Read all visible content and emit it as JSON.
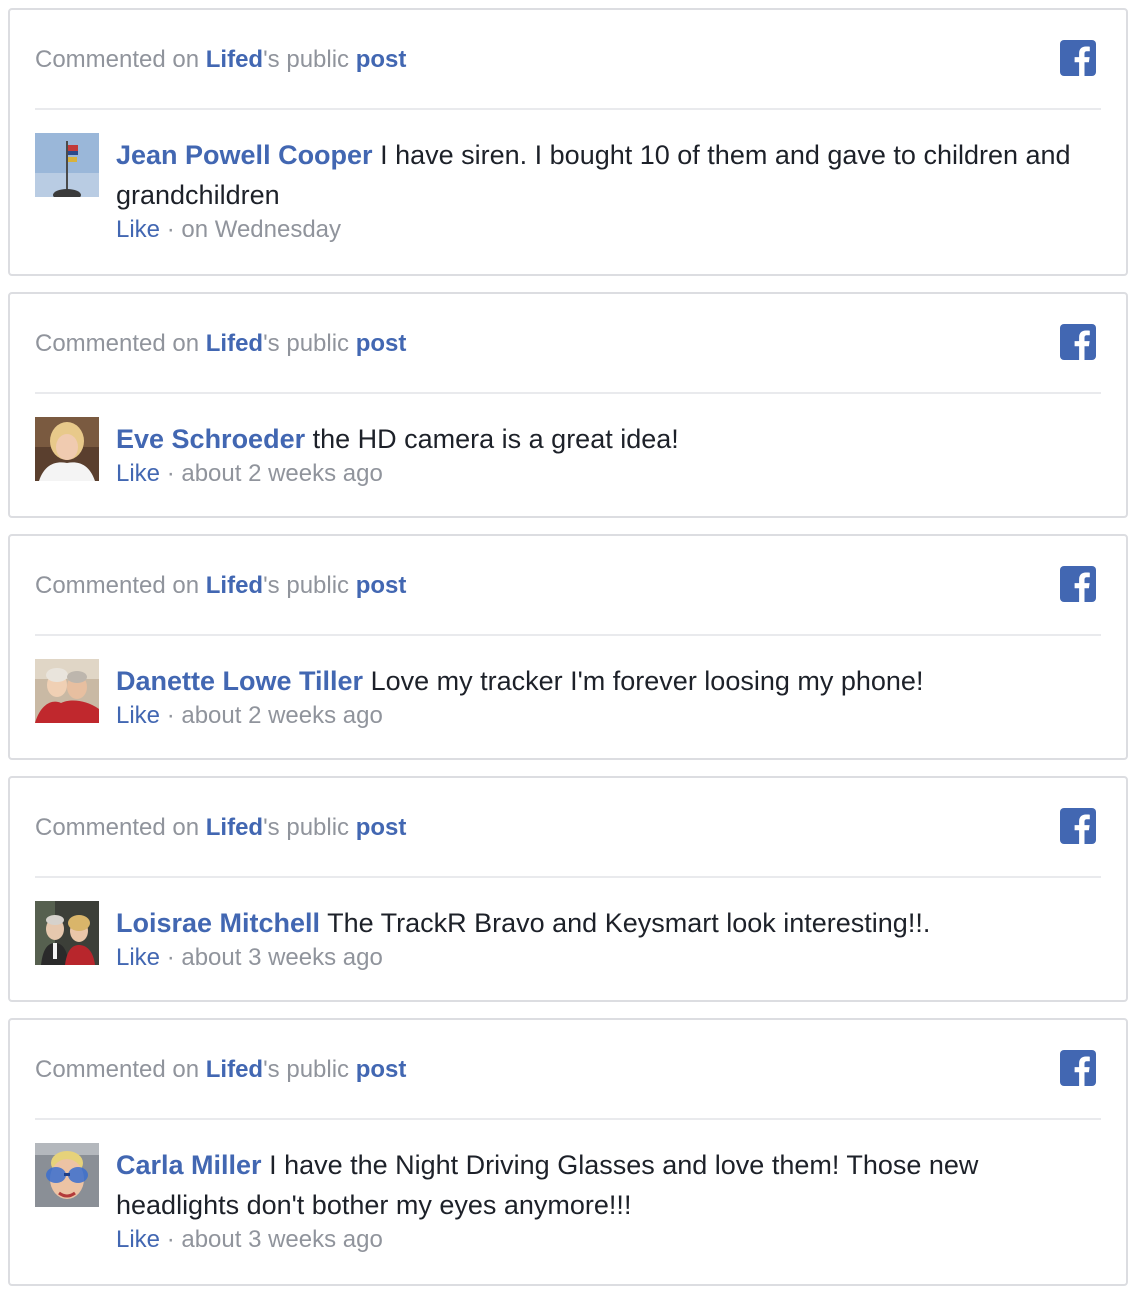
{
  "colors": {
    "link": "#4267b2",
    "muted": "#90949c",
    "text": "#1d2129",
    "border": "#dcdde1",
    "facebook": "#4267b2"
  },
  "header": {
    "prefix": "Commented on ",
    "page": "Lifed",
    "middle": "'s public ",
    "post": "post"
  },
  "meta": {
    "like": "Like",
    "separator": " · "
  },
  "icons": {
    "brand": "facebook-icon"
  },
  "comments": [
    {
      "author": "Jean Powell Cooper",
      "text": " I have siren. I bought 10 of them and gave to children and grandchildren",
      "time": "on Wednesday",
      "avatar": "flag-pole-photo"
    },
    {
      "author": "Eve Schroeder",
      "text": " the HD camera is a great idea!",
      "time": "about 2 weeks ago",
      "avatar": "woman-portrait-photo"
    },
    {
      "author": "Danette Lowe Tiller",
      "text": " Love my tracker I'm forever loosing my phone!",
      "time": "about 2 weeks ago",
      "avatar": "couple-photo"
    },
    {
      "author": "Loisrae Mitchell",
      "text": " The TrackR Bravo and Keysmart look interesting!!.",
      "time": "about 3 weeks ago",
      "avatar": "couple-photo"
    },
    {
      "author": "Carla Miller",
      "text": " I have the Night Driving Glasses and love them! Those new headlights don't bother my eyes anymore!!!",
      "time": "about 3 weeks ago",
      "avatar": "woman-glasses-photo"
    }
  ]
}
